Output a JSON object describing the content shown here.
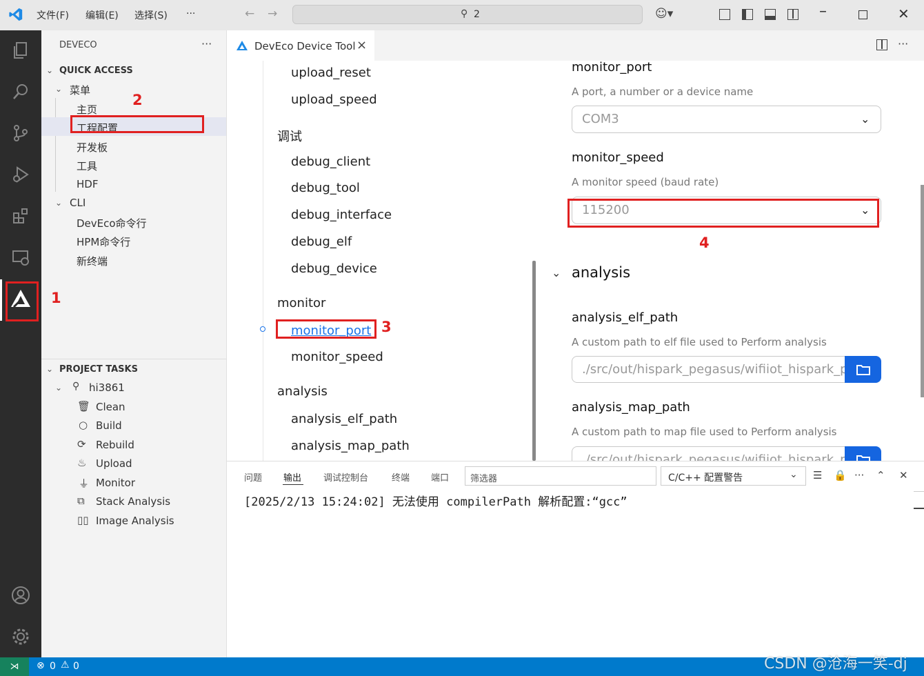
{
  "menu": {
    "file": "文件(F)",
    "edit": "编辑(E)",
    "select": "选择(S)",
    "more": "···"
  },
  "search": {
    "value": "2"
  },
  "sidebar": {
    "title": "DEVECO",
    "more": "···",
    "quick_access": "QUICK ACCESS",
    "menu_group": "菜单",
    "menu_items": [
      "主页",
      "工程配置",
      "开发板",
      "工具",
      "HDF"
    ],
    "cli_group": "CLI",
    "cli_items": [
      "DevEco命令行",
      "HPM命令行",
      "新终端"
    ],
    "project_tasks": "PROJECT TASKS",
    "project": "hi3861",
    "tasks": [
      "Clean",
      "Build",
      "Rebuild",
      "Upload",
      "Monitor",
      "Stack Analysis",
      "Image Analysis"
    ]
  },
  "tab": {
    "label": "DevEco Device Tool",
    "close": "×"
  },
  "nav": {
    "items_top": [
      "upload_reset",
      "upload_speed"
    ],
    "debug_head": "调试",
    "debug_items": [
      "debug_client",
      "debug_tool",
      "debug_interface",
      "debug_elf",
      "debug_device"
    ],
    "monitor_head": "monitor",
    "monitor_items": [
      "monitor_port",
      "monitor_speed"
    ],
    "analysis_head": "analysis",
    "analysis_items": [
      "analysis_elf_path",
      "analysis_map_path"
    ]
  },
  "settings": {
    "monitor_port": {
      "title": "monitor_port",
      "desc": "A port, a number or a device name",
      "value": "COM3"
    },
    "monitor_speed": {
      "title": "monitor_speed",
      "desc": "A monitor speed (baud rate)",
      "value": "115200"
    },
    "analysis_section": "analysis",
    "analysis_elf_path": {
      "title": "analysis_elf_path",
      "desc": "A custom path to elf file used to Perform analysis",
      "value": "./src/out/hispark_pegasus/wifiiot_hispark_pe"
    },
    "analysis_map_path": {
      "title": "analysis_map_path",
      "desc": "A custom path to map file used to Perform analysis",
      "value": "./src/out/hispark_pegasus/wifiiot_hispark_pe"
    }
  },
  "annotations": [
    "1",
    "2",
    "3",
    "4"
  ],
  "panel": {
    "tabs": [
      "问题",
      "输出",
      "调试控制台",
      "终端",
      "端口"
    ],
    "active_tab": "输出",
    "filter_placeholder": "筛选器",
    "channel": "C/C++ 配置警告",
    "output_line": "[2025/2/13 15:24:02] 无法使用 compilerPath 解析配置:“gcc”"
  },
  "status": {
    "errors": "0",
    "warnings": "0"
  },
  "watermark": "CSDN @沧海一笑-dj",
  "colors": {
    "accent": "#007acc",
    "annotation": "#e02020",
    "link": "#1a73e8",
    "browse_button": "#1565e0"
  }
}
